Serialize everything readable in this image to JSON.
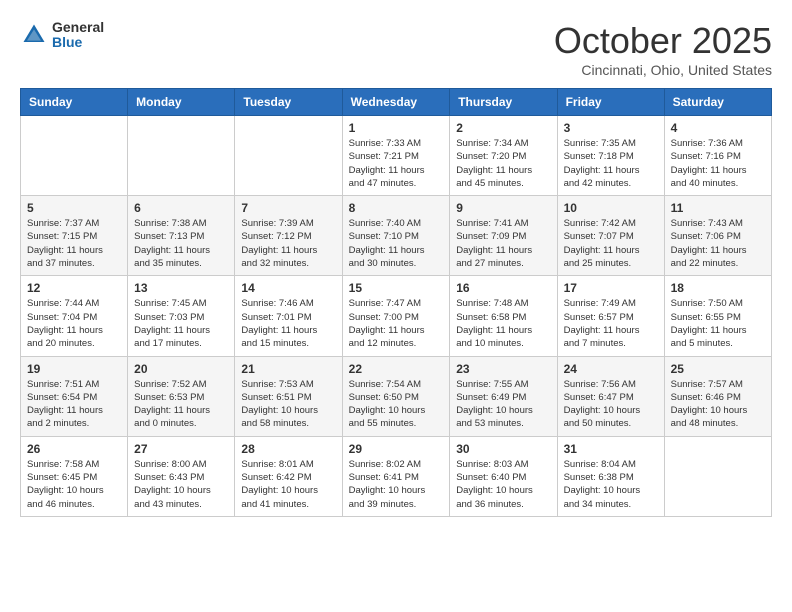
{
  "header": {
    "logo_general": "General",
    "logo_blue": "Blue",
    "month_title": "October 2025",
    "location": "Cincinnati, Ohio, United States"
  },
  "days_of_week": [
    "Sunday",
    "Monday",
    "Tuesday",
    "Wednesday",
    "Thursday",
    "Friday",
    "Saturday"
  ],
  "weeks": [
    [
      {
        "day": "",
        "info": ""
      },
      {
        "day": "",
        "info": ""
      },
      {
        "day": "",
        "info": ""
      },
      {
        "day": "1",
        "info": "Sunrise: 7:33 AM\nSunset: 7:21 PM\nDaylight: 11 hours\nand 47 minutes."
      },
      {
        "day": "2",
        "info": "Sunrise: 7:34 AM\nSunset: 7:20 PM\nDaylight: 11 hours\nand 45 minutes."
      },
      {
        "day": "3",
        "info": "Sunrise: 7:35 AM\nSunset: 7:18 PM\nDaylight: 11 hours\nand 42 minutes."
      },
      {
        "day": "4",
        "info": "Sunrise: 7:36 AM\nSunset: 7:16 PM\nDaylight: 11 hours\nand 40 minutes."
      }
    ],
    [
      {
        "day": "5",
        "info": "Sunrise: 7:37 AM\nSunset: 7:15 PM\nDaylight: 11 hours\nand 37 minutes."
      },
      {
        "day": "6",
        "info": "Sunrise: 7:38 AM\nSunset: 7:13 PM\nDaylight: 11 hours\nand 35 minutes."
      },
      {
        "day": "7",
        "info": "Sunrise: 7:39 AM\nSunset: 7:12 PM\nDaylight: 11 hours\nand 32 minutes."
      },
      {
        "day": "8",
        "info": "Sunrise: 7:40 AM\nSunset: 7:10 PM\nDaylight: 11 hours\nand 30 minutes."
      },
      {
        "day": "9",
        "info": "Sunrise: 7:41 AM\nSunset: 7:09 PM\nDaylight: 11 hours\nand 27 minutes."
      },
      {
        "day": "10",
        "info": "Sunrise: 7:42 AM\nSunset: 7:07 PM\nDaylight: 11 hours\nand 25 minutes."
      },
      {
        "day": "11",
        "info": "Sunrise: 7:43 AM\nSunset: 7:06 PM\nDaylight: 11 hours\nand 22 minutes."
      }
    ],
    [
      {
        "day": "12",
        "info": "Sunrise: 7:44 AM\nSunset: 7:04 PM\nDaylight: 11 hours\nand 20 minutes."
      },
      {
        "day": "13",
        "info": "Sunrise: 7:45 AM\nSunset: 7:03 PM\nDaylight: 11 hours\nand 17 minutes."
      },
      {
        "day": "14",
        "info": "Sunrise: 7:46 AM\nSunset: 7:01 PM\nDaylight: 11 hours\nand 15 minutes."
      },
      {
        "day": "15",
        "info": "Sunrise: 7:47 AM\nSunset: 7:00 PM\nDaylight: 11 hours\nand 12 minutes."
      },
      {
        "day": "16",
        "info": "Sunrise: 7:48 AM\nSunset: 6:58 PM\nDaylight: 11 hours\nand 10 minutes."
      },
      {
        "day": "17",
        "info": "Sunrise: 7:49 AM\nSunset: 6:57 PM\nDaylight: 11 hours\nand 7 minutes."
      },
      {
        "day": "18",
        "info": "Sunrise: 7:50 AM\nSunset: 6:55 PM\nDaylight: 11 hours\nand 5 minutes."
      }
    ],
    [
      {
        "day": "19",
        "info": "Sunrise: 7:51 AM\nSunset: 6:54 PM\nDaylight: 11 hours\nand 2 minutes."
      },
      {
        "day": "20",
        "info": "Sunrise: 7:52 AM\nSunset: 6:53 PM\nDaylight: 11 hours\nand 0 minutes."
      },
      {
        "day": "21",
        "info": "Sunrise: 7:53 AM\nSunset: 6:51 PM\nDaylight: 10 hours\nand 58 minutes."
      },
      {
        "day": "22",
        "info": "Sunrise: 7:54 AM\nSunset: 6:50 PM\nDaylight: 10 hours\nand 55 minutes."
      },
      {
        "day": "23",
        "info": "Sunrise: 7:55 AM\nSunset: 6:49 PM\nDaylight: 10 hours\nand 53 minutes."
      },
      {
        "day": "24",
        "info": "Sunrise: 7:56 AM\nSunset: 6:47 PM\nDaylight: 10 hours\nand 50 minutes."
      },
      {
        "day": "25",
        "info": "Sunrise: 7:57 AM\nSunset: 6:46 PM\nDaylight: 10 hours\nand 48 minutes."
      }
    ],
    [
      {
        "day": "26",
        "info": "Sunrise: 7:58 AM\nSunset: 6:45 PM\nDaylight: 10 hours\nand 46 minutes."
      },
      {
        "day": "27",
        "info": "Sunrise: 8:00 AM\nSunset: 6:43 PM\nDaylight: 10 hours\nand 43 minutes."
      },
      {
        "day": "28",
        "info": "Sunrise: 8:01 AM\nSunset: 6:42 PM\nDaylight: 10 hours\nand 41 minutes."
      },
      {
        "day": "29",
        "info": "Sunrise: 8:02 AM\nSunset: 6:41 PM\nDaylight: 10 hours\nand 39 minutes."
      },
      {
        "day": "30",
        "info": "Sunrise: 8:03 AM\nSunset: 6:40 PM\nDaylight: 10 hours\nand 36 minutes."
      },
      {
        "day": "31",
        "info": "Sunrise: 8:04 AM\nSunset: 6:38 PM\nDaylight: 10 hours\nand 34 minutes."
      },
      {
        "day": "",
        "info": ""
      }
    ]
  ]
}
